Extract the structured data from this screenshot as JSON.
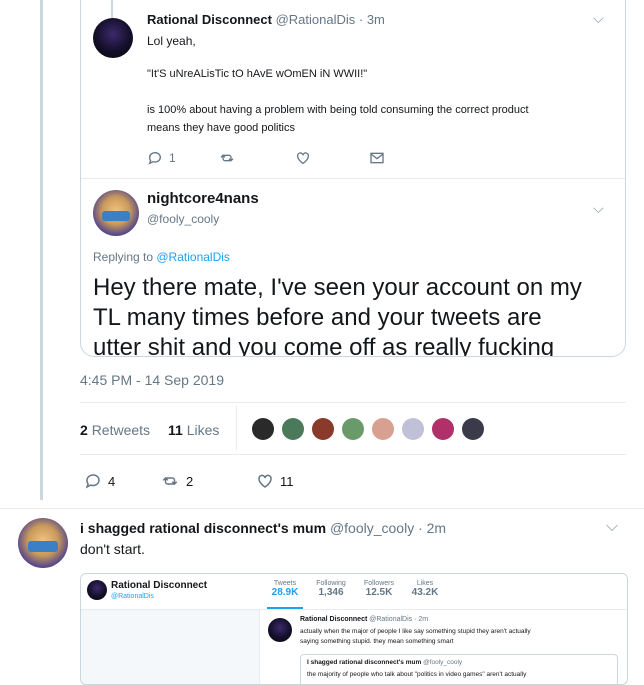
{
  "quoted": {
    "name": "Rational Disconnect",
    "handle": "@RationalDis",
    "time": "· 3m",
    "line1": "Lol yeah,",
    "line2": "\"It'S uNreALisTic tO hAvE wOmEN iN WWII!\"",
    "line3": "is 100% about having a problem with being told consuming the correct product",
    "line4": "means they have good politics",
    "reply_count": "1"
  },
  "reply": {
    "name": "nightcore4nans",
    "handle": "@fooly_cooly",
    "replying_prefix": "Replying to ",
    "replying_handle": "@RationalDis",
    "text_line1": "Hey there mate, I've seen your account on my",
    "text_line2": "TL many times before and your tweets are",
    "text_line3": "utter shit and you come off as really fucking"
  },
  "main": {
    "timestamp": "4:45 PM - 14 Sep 2019",
    "retweets_num": "2",
    "retweets_label": "Retweets",
    "likes_num": "11",
    "likes_label": "Likes",
    "reply_count": "4",
    "retweet_count": "2",
    "like_count": "11"
  },
  "bottom": {
    "name": "i shagged rational disconnect's mum",
    "handle": "@fooly_cooly",
    "time": "· 2m",
    "text": "don't start."
  },
  "embed": {
    "profile_name": "Rational Disconnect",
    "profile_handle": "@RationalDis",
    "stats": [
      {
        "label": "Tweets",
        "value": "28.9K"
      },
      {
        "label": "Following",
        "value": "1,346"
      },
      {
        "label": "Followers",
        "value": "12.5K"
      },
      {
        "label": "Likes",
        "value": "43.2K"
      }
    ],
    "tweet_name": "Rational Disconnect",
    "tweet_handle": "@RationalDis · 2m",
    "tweet_line1": "actually when the major of people I like say something stupid they aren't actually",
    "tweet_line2": "saying something stupid. they mean something smart",
    "inner_name": "I shagged rational disconnect's mum",
    "inner_handle": "@fooly_cooly",
    "inner_line": "the majority of people who talk about \"politics in video games\" aren't actually"
  },
  "colors": {
    "accent": "#1da1f2",
    "muted": "#657786",
    "border": "#ccd6dd"
  }
}
